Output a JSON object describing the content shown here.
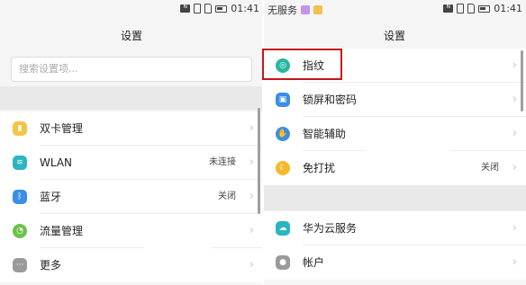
{
  "left": {
    "status": {
      "time": "01:41"
    },
    "title": "设置",
    "search": {
      "placeholder": "搜索设置项..."
    },
    "items": [
      {
        "label": "双卡管理",
        "value": "",
        "icon": "sim-card-icon",
        "color": "#f6c344"
      },
      {
        "label": "WLAN",
        "value": "未连接",
        "icon": "wifi-icon",
        "color": "#2bb5c2"
      },
      {
        "label": "蓝牙",
        "value": "关闭",
        "icon": "bluetooth-icon",
        "color": "#3a8ee6"
      },
      {
        "label": "流量管理",
        "value": "",
        "icon": "data-usage-icon",
        "color": "#6cc24a"
      },
      {
        "label": "更多",
        "value": "",
        "icon": "more-icon",
        "color": "#9a9a9a"
      }
    ]
  },
  "right": {
    "status": {
      "carrier": "无服务",
      "time": "01:41",
      "notif_colors": [
        "#c792ea",
        "#f0c14b"
      ]
    },
    "title": "设置",
    "items": [
      {
        "label": "指纹",
        "value": "",
        "icon": "fingerprint-icon",
        "color": "#27b6a0"
      },
      {
        "label": "锁屏和密码",
        "value": "",
        "icon": "lock-icon",
        "color": "#3a8ee6"
      },
      {
        "label": "智能辅助",
        "value": "",
        "icon": "hand-icon",
        "color": "#3a8ee6"
      },
      {
        "label": "免打扰",
        "value": "关闭",
        "icon": "moon-icon",
        "color": "#f6b92b"
      },
      {
        "label": "华为云服务",
        "value": "",
        "icon": "cloud-icon",
        "color": "#2bb5c2"
      },
      {
        "label": "帐户",
        "value": "",
        "icon": "account-icon",
        "color": "#9a9a9a"
      }
    ]
  }
}
